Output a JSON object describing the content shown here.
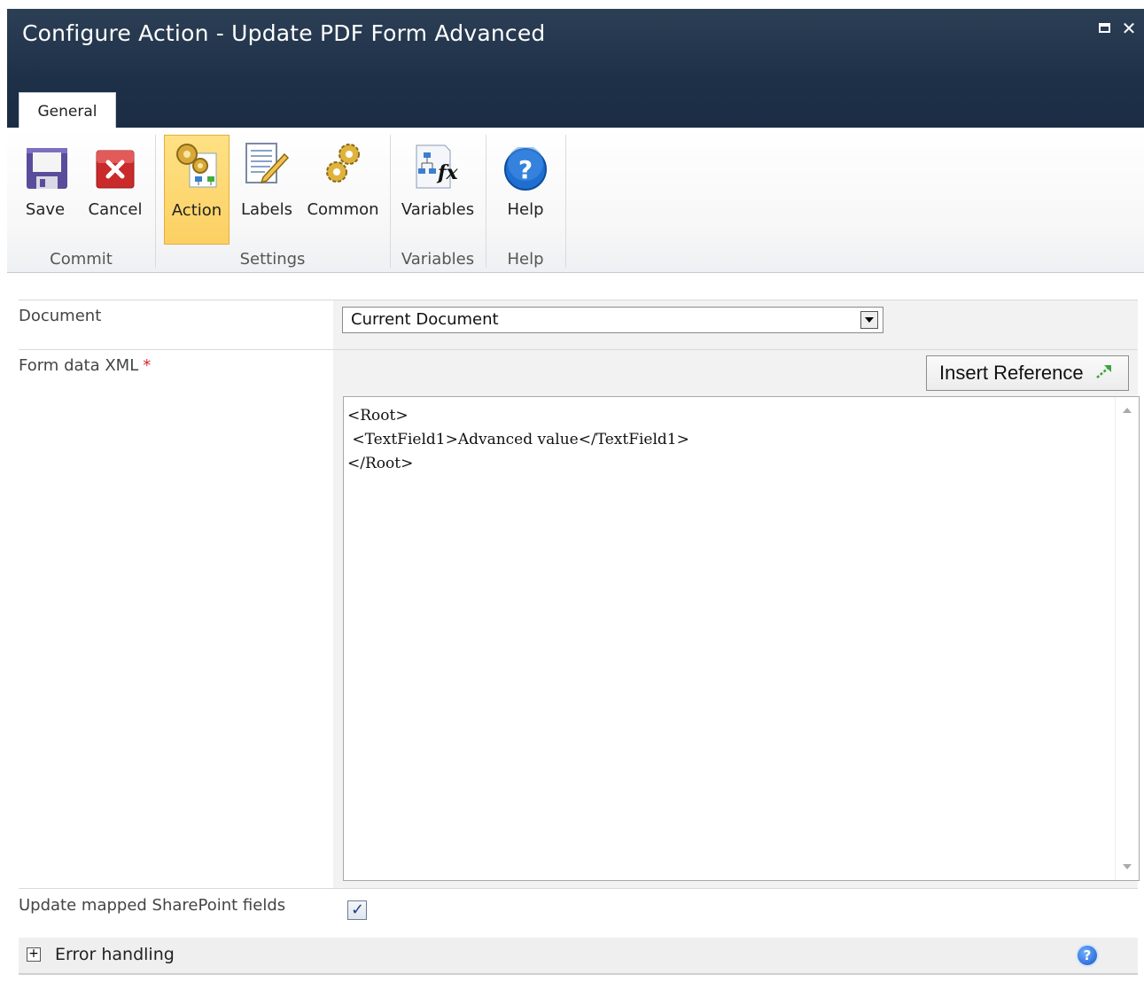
{
  "window": {
    "title": "Configure Action - Update PDF Form Advanced",
    "maximize_icon": "maximize-icon",
    "close_icon": "close-icon",
    "close_glyph": "✕",
    "theme_color": "#1d3048"
  },
  "tabs": [
    {
      "label": "General",
      "active": true
    }
  ],
  "ribbon": {
    "buttons": {
      "save": {
        "label": "Save",
        "icon": "floppy-disk-icon"
      },
      "cancel": {
        "label": "Cancel",
        "icon": "red-x-icon"
      },
      "action": {
        "label": "Action",
        "icon": "gears-workflow-icon",
        "selected": true
      },
      "labels": {
        "label": "Labels",
        "icon": "notepad-pencil-icon"
      },
      "common": {
        "label": "Common",
        "icon": "gears-icon"
      },
      "variables": {
        "label": "Variables",
        "icon": "fx-diagram-icon"
      },
      "help": {
        "label": "Help",
        "icon": "question-icon"
      }
    },
    "groups": {
      "commit": "Commit",
      "settings": "Settings",
      "variables": "Variables",
      "help": "Help"
    },
    "active_color": "#fcd063"
  },
  "form": {
    "document": {
      "label": "Document",
      "value": "Current Document"
    },
    "form_data_xml": {
      "label": "Form data XML",
      "required_mark": "*",
      "insert_reference_label": "Insert Reference",
      "value": "<Root>\n <TextField1>Advanced value</TextField1>\n</Root>"
    },
    "update_mapped": {
      "label": "Update mapped SharePoint fields",
      "checked": true,
      "check_glyph": "✓"
    },
    "error_handling": {
      "label": "Error handling",
      "expand_glyph": "+",
      "help_glyph": "?"
    }
  }
}
